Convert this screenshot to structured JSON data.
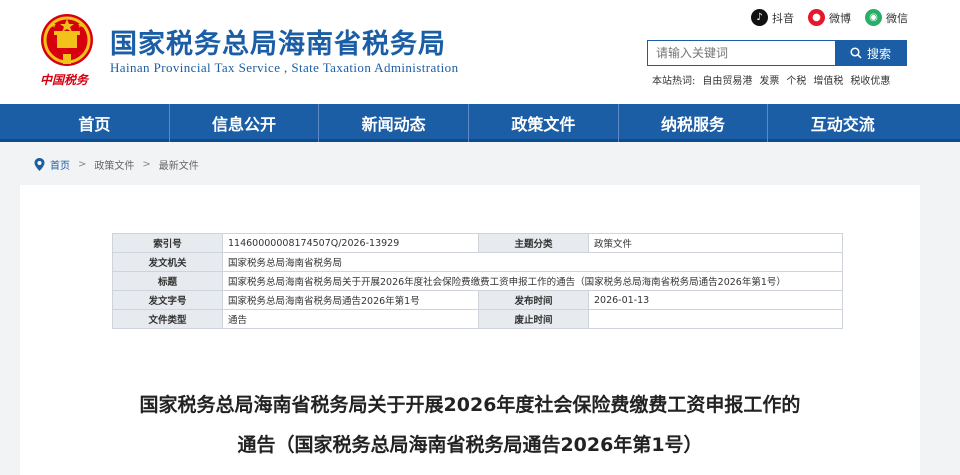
{
  "header": {
    "site_title": "国家税务总局海南省税务局",
    "site_subtitle": "Hainan Provincial Tax Service , State Taxation Administration",
    "logo_caption": "中国税务",
    "social": [
      {
        "label": "抖音",
        "icon": "tiktok-icon",
        "color": "#111111"
      },
      {
        "label": "微博",
        "icon": "weibo-icon",
        "color": "#e6162d"
      },
      {
        "label": "微信",
        "icon": "wechat-icon",
        "color": "#2aae67"
      }
    ],
    "search": {
      "placeholder": "请输入关键词",
      "button_label": "搜索"
    },
    "hotwords": {
      "label": "本站热词:",
      "items": [
        "自由贸易港",
        "发票",
        "个税",
        "增值税",
        "税收优惠"
      ]
    }
  },
  "nav": {
    "items": [
      "首页",
      "信息公开",
      "新闻动态",
      "政策文件",
      "纳税服务",
      "互动交流"
    ]
  },
  "breadcrumb": {
    "items": [
      "首页",
      "政策文件",
      "最新文件"
    ]
  },
  "meta": {
    "index_no": {
      "label": "索引号",
      "value": "11460000008174507Q/2026-13929"
    },
    "category": {
      "label": "主题分类",
      "value": "政策文件"
    },
    "issuer": {
      "label": "发文机关",
      "value": "国家税务总局海南省税务局"
    },
    "title": {
      "label": "标题",
      "value": "国家税务总局海南省税务局关于开展2026年度社会保险费缴费工资申报工作的通告（国家税务总局海南省税务局通告2026年第1号）"
    },
    "doc_no": {
      "label": "发文字号",
      "value": "国家税务总局海南省税务局通告2026年第1号"
    },
    "pub_date": {
      "label": "发布时间",
      "value": "2026-01-13"
    },
    "doc_type": {
      "label": "文件类型",
      "value": "通告"
    },
    "repeal_date": {
      "label": "废止时间",
      "value": ""
    }
  },
  "article": {
    "title_line1": "国家税务总局海南省税务局关于开展2026年度社会保险费缴费工资申报工作的",
    "title_line2": "通告（国家税务总局海南省税务局通告2026年第1号）"
  },
  "colors": {
    "brand_blue": "#1b5ea6",
    "emblem_red": "#d7000f",
    "emblem_gold": "#f2c21b"
  }
}
